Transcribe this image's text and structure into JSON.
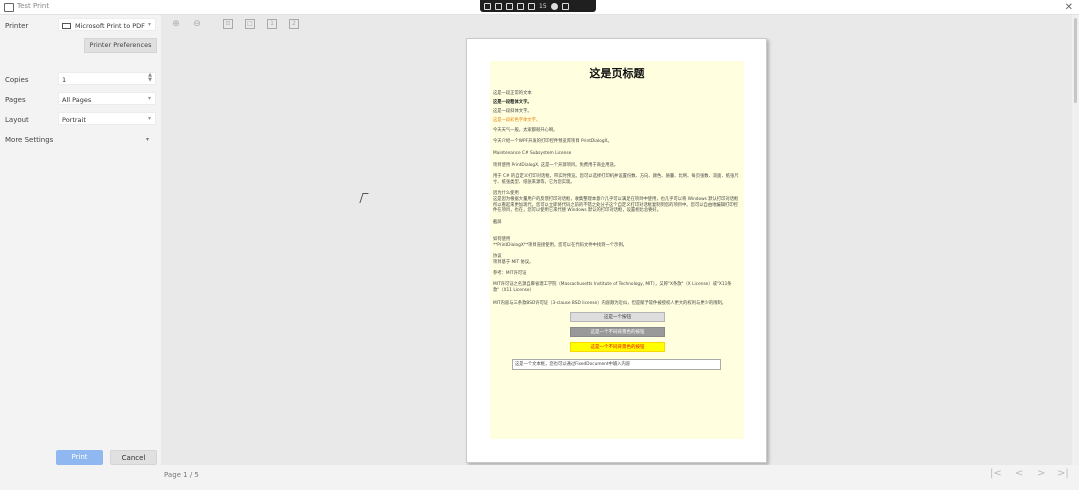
{
  "window": {
    "title": "Test Print",
    "close_glyph": "✕",
    "remote_bar": {
      "signal": "15"
    }
  },
  "settings": {
    "printer": {
      "label": "Printer",
      "value": "Microsoft Print to PDF"
    },
    "printer_preferences": "Printer Preferences",
    "copies": {
      "label": "Copies",
      "value": "1"
    },
    "pages": {
      "label": "Pages",
      "value": "All Pages"
    },
    "layout": {
      "label": "Layout",
      "value": "Portrait"
    },
    "more_settings": "More Settings",
    "print_button": "Print",
    "cancel_button": "Cancel"
  },
  "toolbar": {
    "icons": [
      "zoom-in-icon",
      "zoom-out-icon",
      "fit-page-icon",
      "actual-size-icon",
      "single-page-icon",
      "two-page-icon"
    ]
  },
  "pager": {
    "label": "Page 1 / 5",
    "first": "|<",
    "prev": "<",
    "next": ">",
    "last": ">|"
  },
  "document": {
    "heading": "这是页标题",
    "lines": [
      {
        "text": "这是一段正常的文本",
        "style": "normal"
      },
      {
        "text": "这是一段粗体文字。",
        "style": "bold"
      },
      {
        "text": "这是一段斜体文字。",
        "style": "normal"
      },
      {
        "text": "这是一段彩色字体文字。",
        "style": "orange"
      },
      {
        "text": "今天天气一般，太家都很开心啊。",
        "style": "normal"
      },
      {
        "text": "今天介绍一个WPF开发的打印控件预览库项目 PrintDialogX。",
        "style": "normal"
      },
      {
        "text": "Maintenance C# Subsystem License",
        "style": "normal"
      },
      {
        "text": "项目使用 PrintDialogX, 这是一个开源项目。免费用于商业用途。",
        "style": "normal"
      },
      {
        "text": "用于 C# 的自定义打印对话框，带实时预览。您可以选择打印机并设置份数、方向、颜色、质量、比例、每页张数、双面、纸张尺寸、纸张类型、纸张来源等，它为您实现。",
        "style": "normal"
      },
      {
        "text": "因为什么使用",
        "style": "normal"
      },
      {
        "text": "这是因为根据大量用户的反馈打印对话框，收集整理本意介几乎可以满足在项目中使用，也几乎可以将 Windows 默认打印对话框所以看起来更加现代，您可以立即将代码之前的不错之处分子这个自定义打印对话框复制到您的项目中。您可以自由地编辑打印控件在项目，也在，您可以使用它来代替 Windows 默认的打印对话框，设置相比总要好。",
        "style": "normal"
      },
      {
        "text": "截屏",
        "style": "normal"
      },
      {
        "text": "如何使用",
        "style": "normal"
      },
      {
        "text": "**PrintDialogX**项目直接使用，您可以在代码文件中找到一个示例。",
        "style": "normal"
      },
      {
        "text": "协议",
        "style": "normal"
      },
      {
        "text": "项目基于 MIT 协议。",
        "style": "normal"
      },
      {
        "text": "参考：MIT许可证",
        "style": "normal"
      },
      {
        "text": "MIT许可证之名源自麻省理工学院（Massachusetts Institute of Technology, MIT），又称\"X条款\"（X License）或\"X11条款\"（X11 License）",
        "style": "normal"
      },
      {
        "text": "MIT内容与三条款BSD许可证（3-clause BSD license）内容颇为近似，但是赋予软件被授权人更大的权利与更少的限制。",
        "style": "normal"
      }
    ],
    "buttons": [
      {
        "label": "这是一个按钮",
        "style": "default"
      },
      {
        "label": "这是一个不同背景色的按钮",
        "style": "gray"
      },
      {
        "label": "这是一个不同背景色的按钮",
        "style": "yellow"
      }
    ],
    "textbox": "这是一个文本框，您也可以通过FixedDocument中输入内容"
  }
}
